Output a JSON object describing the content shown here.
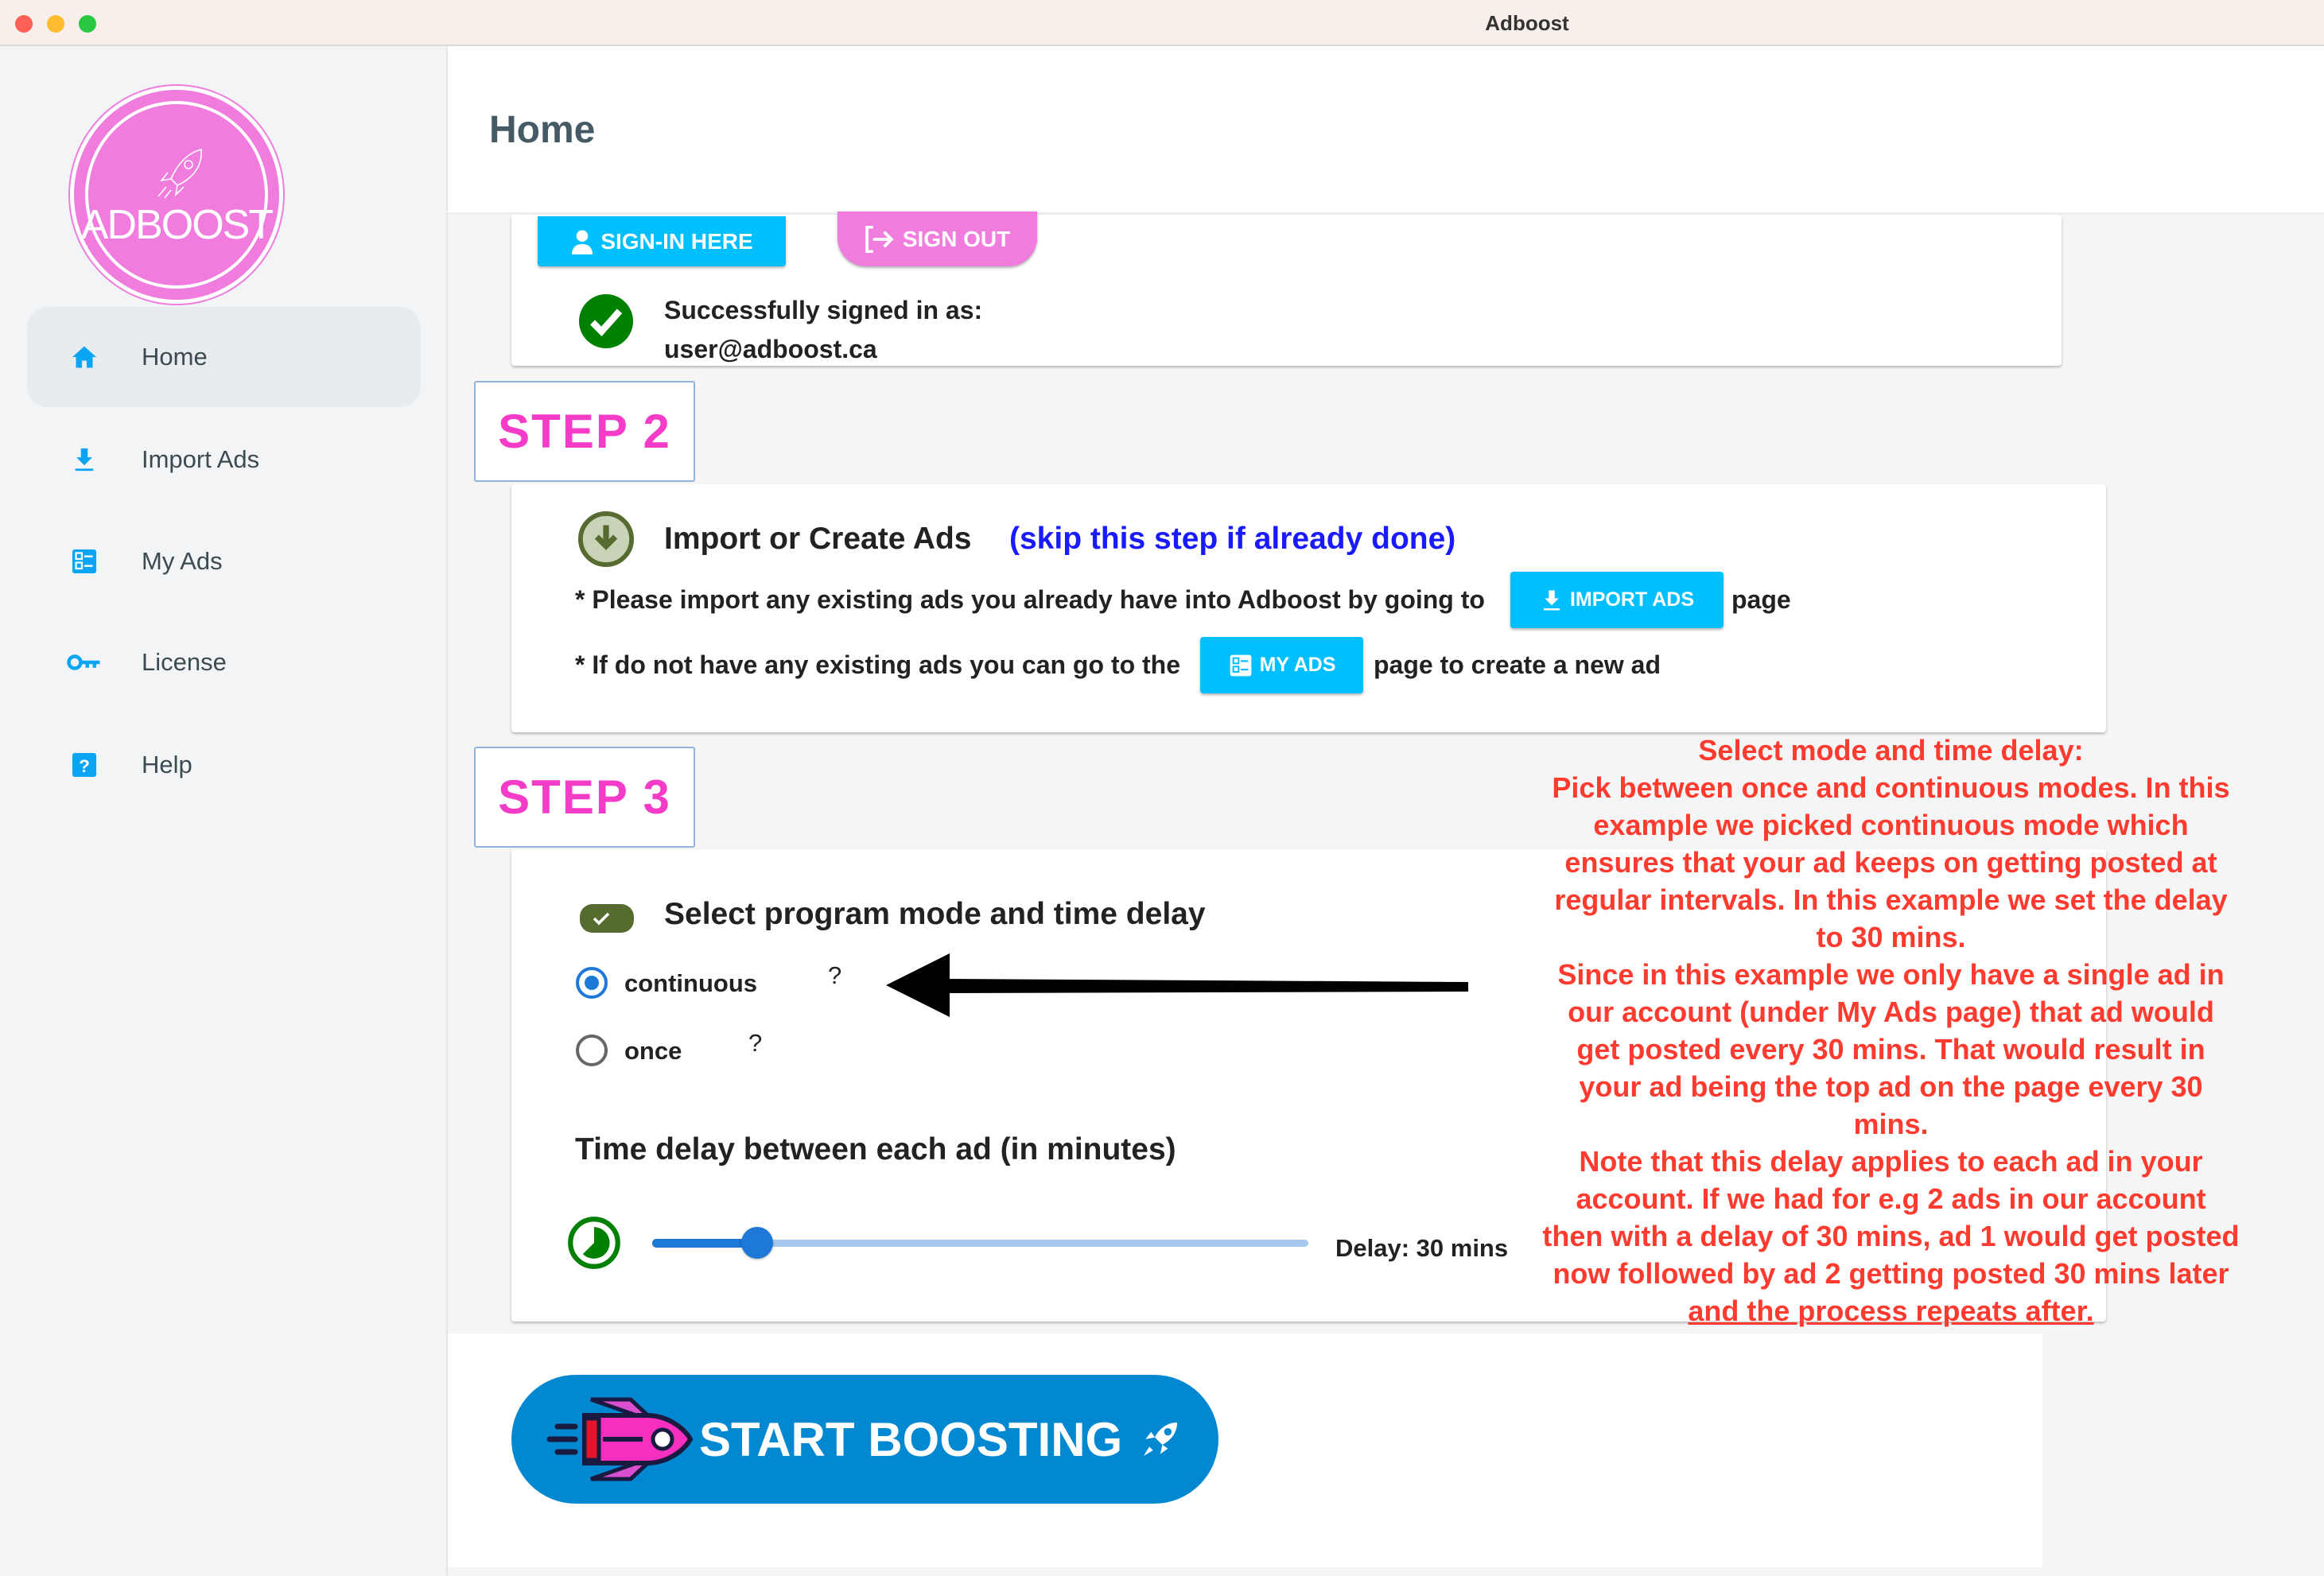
{
  "window": {
    "title": "Adboost",
    "controls": [
      "close",
      "minimize",
      "zoom"
    ]
  },
  "logo": {
    "text": "ADBOOST"
  },
  "sidebar": {
    "items": [
      {
        "label": "Home",
        "icon": "home-icon",
        "active": true
      },
      {
        "label": "Import Ads",
        "icon": "download-icon"
      },
      {
        "label": "My Ads",
        "icon": "list-icon"
      },
      {
        "label": "License",
        "icon": "key-icon"
      },
      {
        "label": "Help",
        "icon": "help-icon"
      }
    ]
  },
  "header": {
    "title": "Home"
  },
  "step1": {
    "signin_label": "SIGN-IN HERE",
    "signout_label": "SIGN OUT",
    "status_line1": "Successfully signed in as:",
    "status_email": "user@adboost.ca"
  },
  "step2": {
    "badge": "STEP 2",
    "title": "Import or Create Ads",
    "note": "(skip this step if already done)",
    "line1_pre": "* Please import any existing ads you already have into Adboost by going to",
    "import_button": "IMPORT ADS",
    "line1_post": "page",
    "line2_pre": "* If do not have any existing ads you can go to the",
    "myads_button": "MY ADS",
    "line2_post": "page to create a new ad"
  },
  "step3": {
    "badge": "STEP 3",
    "title": "Select program mode and time delay",
    "modes": [
      {
        "label": "continuous",
        "help": "?",
        "selected": true
      },
      {
        "label": "once",
        "help": "?",
        "selected": false
      }
    ],
    "delay_title": "Time delay between each ad (in minutes)",
    "delay_label": "Delay: 30 mins",
    "slider_fraction": 0.16
  },
  "start_button": {
    "label": "START BOOSTING"
  },
  "annotation": {
    "color": "#ff3b30",
    "lines": [
      "Select mode and time delay:",
      "Pick between once and continuous modes. In this",
      "example we picked continuous mode which",
      "ensures that your ad keeps on getting posted at",
      "regular intervals. In this example we set the delay",
      "to 30 mins.",
      "Since in this example we only have a single ad in",
      "our account (under My Ads page) that ad would",
      "get posted every 30 mins. That would result in",
      "your ad being the top ad on the page every 30",
      "mins.",
      "Note that this delay applies to each ad in your",
      "account. If we had for e.g 2 ads in our account",
      "then with a delay of 30 mins, ad 1 would get posted",
      "now followed by ad 2 getting posted 30 mins later",
      "and the process repeats after."
    ]
  },
  "colors": {
    "accent": "#00bfff",
    "pink": "#f07cde",
    "step": "#f53cc8",
    "start": "#0288d1",
    "success": "#008000",
    "link": "#1a1aff"
  }
}
